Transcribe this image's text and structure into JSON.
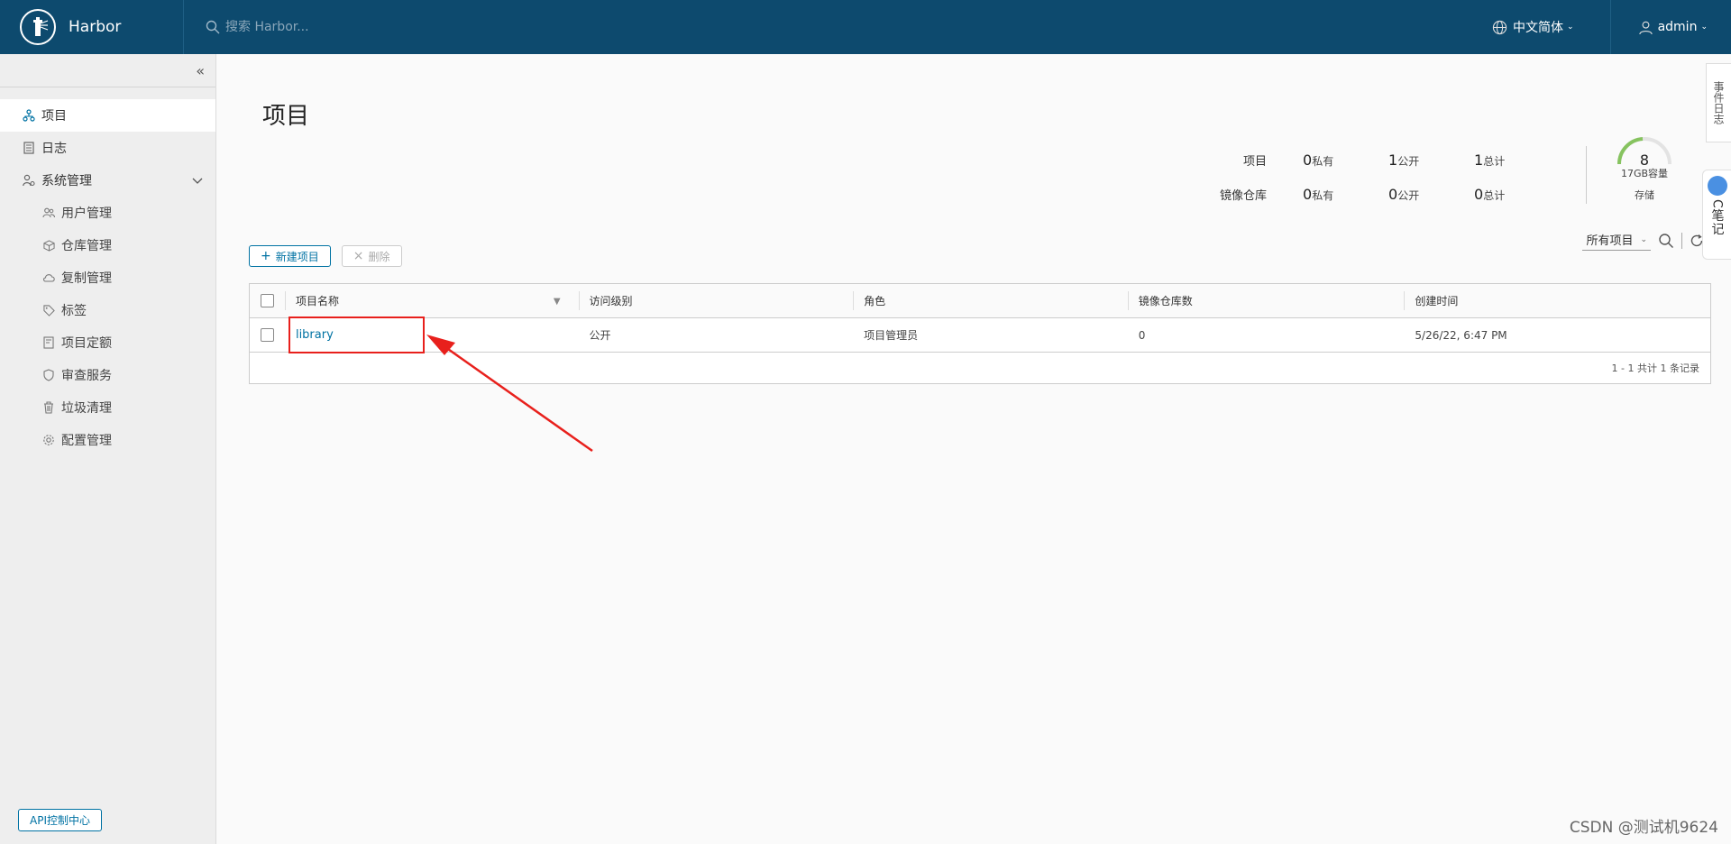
{
  "header": {
    "brand": "Harbor",
    "search_placeholder": "搜索 Harbor...",
    "language": "中文简体",
    "user": "admin"
  },
  "sidebar": {
    "items": [
      {
        "label": "项目",
        "icon": "projects-icon",
        "active": true
      },
      {
        "label": "日志",
        "icon": "log-icon"
      },
      {
        "label": "系统管理",
        "icon": "admin-icon",
        "expanded": true
      }
    ],
    "sub_items": [
      {
        "label": "用户管理",
        "icon": "users-icon"
      },
      {
        "label": "仓库管理",
        "icon": "registry-icon"
      },
      {
        "label": "复制管理",
        "icon": "replication-icon"
      },
      {
        "label": "标签",
        "icon": "tag-icon"
      },
      {
        "label": "项目定额",
        "icon": "quota-icon"
      },
      {
        "label": "审查服务",
        "icon": "shield-icon"
      },
      {
        "label": "垃圾清理",
        "icon": "trash-icon"
      },
      {
        "label": "配置管理",
        "icon": "gear-icon"
      }
    ],
    "api_button": "API控制中心"
  },
  "main": {
    "title": "项目",
    "stats": {
      "rows": [
        {
          "label": "项目",
          "private_n": "0",
          "private_l": "私有",
          "public_n": "1",
          "public_l": "公开",
          "total_n": "1",
          "total_l": "总计"
        },
        {
          "label": "镜像仓库",
          "private_n": "0",
          "private_l": "私有",
          "public_n": "0",
          "public_l": "公开",
          "total_n": "0",
          "total_l": "总计"
        }
      ],
      "storage_number": "8",
      "storage_capacity": "17GB容量",
      "storage_label": "存储"
    },
    "toolbar": {
      "new_project": "新建项目",
      "delete": "删除"
    },
    "filter": {
      "selected": "所有项目"
    },
    "table": {
      "columns": [
        "项目名称",
        "访问级别",
        "角色",
        "镜像仓库数",
        "创建时间"
      ],
      "rows": [
        {
          "name": "library",
          "access": "公开",
          "role": "项目管理员",
          "repo_count": "0",
          "created": "5/26/22, 6:47 PM"
        }
      ],
      "footer": "1 - 1 共计 1 条记录"
    }
  },
  "float_tab": "事件日志",
  "float_note": "C笔记",
  "watermark": "CSDN @测试机9624",
  "colors": {
    "header": "#0d4a6e",
    "accent": "#0072a3",
    "highlight": "#e8201c"
  }
}
